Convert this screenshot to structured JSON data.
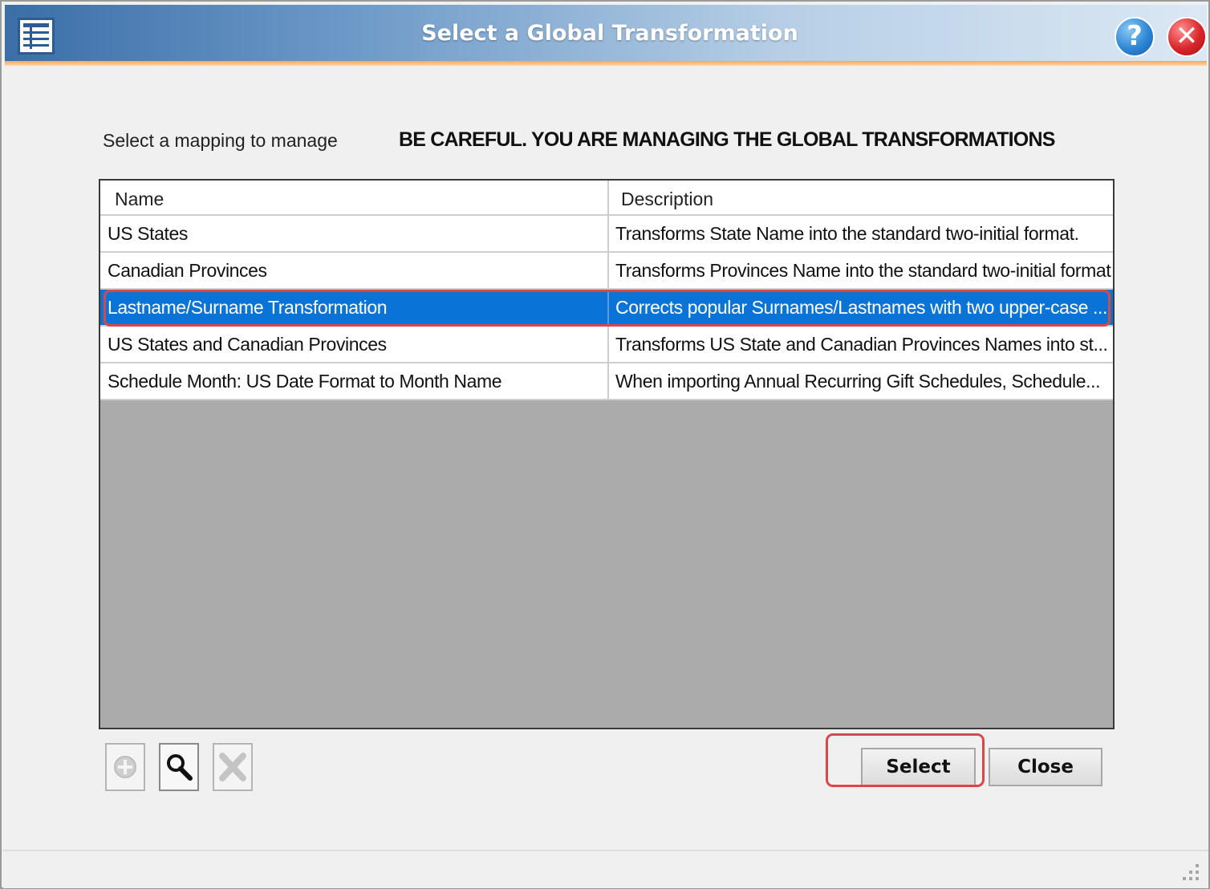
{
  "window": {
    "title": "Select a Global Transformation",
    "help_glyph": "?",
    "close_glyph": "✕"
  },
  "labels": {
    "prompt": "Select a mapping to manage",
    "warning": "BE CAREFUL. YOU ARE MANAGING THE GLOBAL TRANSFORMATIONS"
  },
  "table": {
    "columns": [
      "Name",
      "Description"
    ],
    "selected_index": 2,
    "rows": [
      {
        "name": "US States",
        "description": "Transforms State Name into the standard two-initial format."
      },
      {
        "name": "Canadian Provinces",
        "description": "Transforms Provinces Name into the standard two-initial format"
      },
      {
        "name": "Lastname/Surname Transformation",
        "description": "Corrects popular Surnames/Lastnames with two upper-case ..."
      },
      {
        "name": "US States and Canadian Provinces",
        "description": "Transforms US State and Canadian Provinces Names into st..."
      },
      {
        "name": "Schedule Month: US Date Format to Month Name",
        "description": "When importing Annual Recurring Gift Schedules, Schedule..."
      }
    ]
  },
  "toolbar": {
    "icons": [
      "add-icon",
      "search-icon",
      "delete-icon"
    ]
  },
  "buttons": {
    "select": "Select",
    "close": "Close"
  },
  "colors": {
    "selection": "#0a74d6",
    "highlight_outline": "#d9474a",
    "title_gradient_start": "#3b6ea8"
  }
}
